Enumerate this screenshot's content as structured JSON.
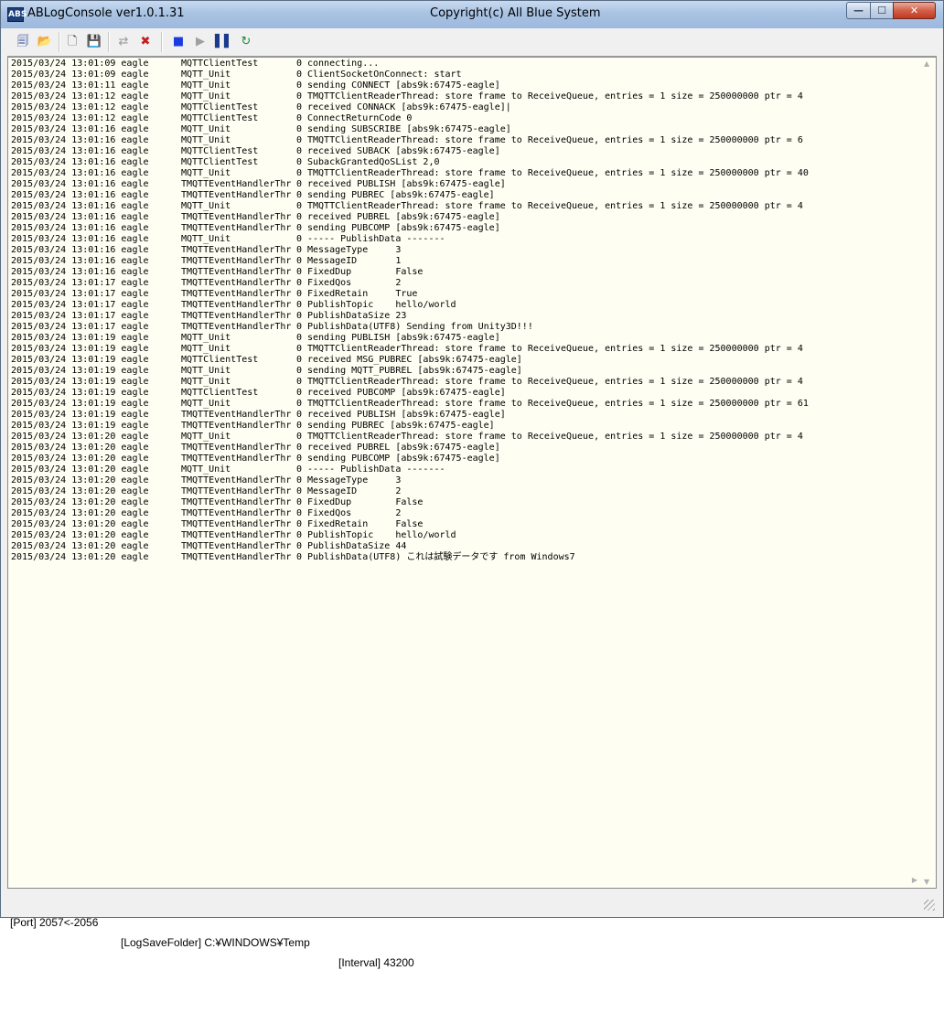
{
  "titlebar": {
    "icon_label": "ABS",
    "app_title": "ABLogConsole ver1.0.1.31",
    "subtitle": "Copyright(c) All Blue System",
    "minimize_glyph": "—",
    "maximize_glyph": "☐",
    "close_glyph": "✕"
  },
  "toolbar": {
    "buttons": [
      {
        "name": "connect-icon",
        "glyph": "🗐",
        "color": "#1a3b8c"
      },
      {
        "name": "open-log-icon",
        "glyph": "📂",
        "color": "#c89a20"
      },
      {
        "name": "new-icon",
        "glyph": "🗋",
        "color": "#404040"
      },
      {
        "name": "save-icon",
        "glyph": "💾",
        "color": "#202020"
      },
      {
        "name": "connect-network-icon",
        "glyph": "⇄",
        "color": "#9a9a9a"
      },
      {
        "name": "disconnect-network-icon",
        "glyph": "✖",
        "color": "#c02020"
      },
      {
        "name": "stop-icon",
        "glyph": "■",
        "color": "#1a3be0"
      },
      {
        "name": "play-icon",
        "glyph": "▶",
        "color": "#a0a0a0"
      },
      {
        "name": "pause-icon",
        "glyph": "▌▌",
        "color": "#1a3b8c"
      },
      {
        "name": "refresh-icon",
        "glyph": "↻",
        "color": "#1f8a3a"
      }
    ]
  },
  "log": [
    {
      "date": "2015/03/24 13:01:09 eagle",
      "source": "MQTTClientTest",
      "level": "0",
      "message": "connecting..."
    },
    {
      "date": "2015/03/24 13:01:09 eagle",
      "source": "MQTT_Unit",
      "level": "0",
      "message": "ClientSocketOnConnect: start"
    },
    {
      "date": "2015/03/24 13:01:11 eagle",
      "source": "MQTT_Unit",
      "level": "0",
      "message": "sending CONNECT [abs9k:67475-eagle]"
    },
    {
      "date": "2015/03/24 13:01:12 eagle",
      "source": "MQTT_Unit",
      "level": "0",
      "message": "TMQTTClientReaderThread: store frame to ReceiveQueue, entries = 1 size = 250000000 ptr = 4"
    },
    {
      "date": "2015/03/24 13:01:12 eagle",
      "source": "MQTTClientTest",
      "level": "0",
      "message": "received CONNACK [abs9k:67475-eagle]|"
    },
    {
      "date": "2015/03/24 13:01:12 eagle",
      "source": "MQTTClientTest",
      "level": "0",
      "message": "ConnectReturnCode 0"
    },
    {
      "date": "2015/03/24 13:01:16 eagle",
      "source": "MQTT_Unit",
      "level": "0",
      "message": "sending SUBSCRIBE [abs9k:67475-eagle]"
    },
    {
      "date": "2015/03/24 13:01:16 eagle",
      "source": "MQTT_Unit",
      "level": "0",
      "message": "TMQTTClientReaderThread: store frame to ReceiveQueue, entries = 1 size = 250000000 ptr = 6"
    },
    {
      "date": "2015/03/24 13:01:16 eagle",
      "source": "MQTTClientTest",
      "level": "0",
      "message": "received SUBACK [abs9k:67475-eagle]"
    },
    {
      "date": "2015/03/24 13:01:16 eagle",
      "source": "MQTTClientTest",
      "level": "0",
      "message": "SubackGrantedQoSList 2,0"
    },
    {
      "date": "2015/03/24 13:01:16 eagle",
      "source": "MQTT_Unit",
      "level": "0",
      "message": "TMQTTClientReaderThread: store frame to ReceiveQueue, entries = 1 size = 250000000 ptr = 40"
    },
    {
      "date": "2015/03/24 13:01:16 eagle",
      "source": "TMQTTEventHandlerThr",
      "level": "0",
      "message": "received PUBLISH [abs9k:67475-eagle]"
    },
    {
      "date": "2015/03/24 13:01:16 eagle",
      "source": "TMQTTEventHandlerThr",
      "level": "0",
      "message": "sending PUBREC [abs9k:67475-eagle]"
    },
    {
      "date": "2015/03/24 13:01:16 eagle",
      "source": "MQTT_Unit",
      "level": "0",
      "message": "TMQTTClientReaderThread: store frame to ReceiveQueue, entries = 1 size = 250000000 ptr = 4"
    },
    {
      "date": "2015/03/24 13:01:16 eagle",
      "source": "TMQTTEventHandlerThr",
      "level": "0",
      "message": "received PUBREL [abs9k:67475-eagle]"
    },
    {
      "date": "2015/03/24 13:01:16 eagle",
      "source": "TMQTTEventHandlerThr",
      "level": "0",
      "message": "sending PUBCOMP [abs9k:67475-eagle]"
    },
    {
      "date": "2015/03/24 13:01:16 eagle",
      "source": "MQTT_Unit",
      "level": "0",
      "message": "----- PublishData -------"
    },
    {
      "date": "2015/03/24 13:01:16 eagle",
      "source": "TMQTTEventHandlerThr",
      "level": "0",
      "message": "MessageType     3"
    },
    {
      "date": "2015/03/24 13:01:16 eagle",
      "source": "TMQTTEventHandlerThr",
      "level": "0",
      "message": "MessageID       1"
    },
    {
      "date": "2015/03/24 13:01:16 eagle",
      "source": "TMQTTEventHandlerThr",
      "level": "0",
      "message": "FixedDup        False"
    },
    {
      "date": "2015/03/24 13:01:17 eagle",
      "source": "TMQTTEventHandlerThr",
      "level": "0",
      "message": "FixedQos        2"
    },
    {
      "date": "2015/03/24 13:01:17 eagle",
      "source": "TMQTTEventHandlerThr",
      "level": "0",
      "message": "FixedRetain     True"
    },
    {
      "date": "2015/03/24 13:01:17 eagle",
      "source": "TMQTTEventHandlerThr",
      "level": "0",
      "message": "PublishTopic    hello/world"
    },
    {
      "date": "2015/03/24 13:01:17 eagle",
      "source": "TMQTTEventHandlerThr",
      "level": "0",
      "message": "PublishDataSize 23"
    },
    {
      "date": "2015/03/24 13:01:17 eagle",
      "source": "TMQTTEventHandlerThr",
      "level": "0",
      "message": "PublishData(UTF8) Sending from Unity3D!!!"
    },
    {
      "date": "2015/03/24 13:01:19 eagle",
      "source": "MQTT_Unit",
      "level": "0",
      "message": "sending PUBLISH [abs9k:67475-eagle]"
    },
    {
      "date": "2015/03/24 13:01:19 eagle",
      "source": "MQTT_Unit",
      "level": "0",
      "message": "TMQTTClientReaderThread: store frame to ReceiveQueue, entries = 1 size = 250000000 ptr = 4"
    },
    {
      "date": "2015/03/24 13:01:19 eagle",
      "source": "MQTTClientTest",
      "level": "0",
      "message": "received MSG_PUBREC [abs9k:67475-eagle]"
    },
    {
      "date": "2015/03/24 13:01:19 eagle",
      "source": "MQTT_Unit",
      "level": "0",
      "message": "sending MQTT_PUBREL [abs9k:67475-eagle]"
    },
    {
      "date": "2015/03/24 13:01:19 eagle",
      "source": "MQTT_Unit",
      "level": "0",
      "message": "TMQTTClientReaderThread: store frame to ReceiveQueue, entries = 1 size = 250000000 ptr = 4"
    },
    {
      "date": "2015/03/24 13:01:19 eagle",
      "source": "MQTTClientTest",
      "level": "0",
      "message": "received PUBCOMP [abs9k:67475-eagle]"
    },
    {
      "date": "2015/03/24 13:01:19 eagle",
      "source": "MQTT_Unit",
      "level": "0",
      "message": "TMQTTClientReaderThread: store frame to ReceiveQueue, entries = 1 size = 250000000 ptr = 61"
    },
    {
      "date": "2015/03/24 13:01:19 eagle",
      "source": "TMQTTEventHandlerThr",
      "level": "0",
      "message": "received PUBLISH [abs9k:67475-eagle]"
    },
    {
      "date": "2015/03/24 13:01:19 eagle",
      "source": "TMQTTEventHandlerThr",
      "level": "0",
      "message": "sending PUBREC [abs9k:67475-eagle]"
    },
    {
      "date": "2015/03/24 13:01:20 eagle",
      "source": "MQTT_Unit",
      "level": "0",
      "message": "TMQTTClientReaderThread: store frame to ReceiveQueue, entries = 1 size = 250000000 ptr = 4"
    },
    {
      "date": "2015/03/24 13:01:20 eagle",
      "source": "TMQTTEventHandlerThr",
      "level": "0",
      "message": "received PUBREL [abs9k:67475-eagle]"
    },
    {
      "date": "2015/03/24 13:01:20 eagle",
      "source": "TMQTTEventHandlerThr",
      "level": "0",
      "message": "sending PUBCOMP [abs9k:67475-eagle]"
    },
    {
      "date": "2015/03/24 13:01:20 eagle",
      "source": "MQTT_Unit",
      "level": "0",
      "message": "----- PublishData -------"
    },
    {
      "date": "2015/03/24 13:01:20 eagle",
      "source": "TMQTTEventHandlerThr",
      "level": "0",
      "message": "MessageType     3"
    },
    {
      "date": "2015/03/24 13:01:20 eagle",
      "source": "TMQTTEventHandlerThr",
      "level": "0",
      "message": "MessageID       2"
    },
    {
      "date": "2015/03/24 13:01:20 eagle",
      "source": "TMQTTEventHandlerThr",
      "level": "0",
      "message": "FixedDup        False"
    },
    {
      "date": "2015/03/24 13:01:20 eagle",
      "source": "TMQTTEventHandlerThr",
      "level": "0",
      "message": "FixedQos        2"
    },
    {
      "date": "2015/03/24 13:01:20 eagle",
      "source": "TMQTTEventHandlerThr",
      "level": "0",
      "message": "FixedRetain     False"
    },
    {
      "date": "2015/03/24 13:01:20 eagle",
      "source": "TMQTTEventHandlerThr",
      "level": "0",
      "message": "PublishTopic    hello/world"
    },
    {
      "date": "2015/03/24 13:01:20 eagle",
      "source": "TMQTTEventHandlerThr",
      "level": "0",
      "message": "PublishDataSize 44"
    },
    {
      "date": "2015/03/24 13:01:20 eagle",
      "source": "TMQTTEventHandlerThr",
      "level": "0",
      "message": "PublishData(UTF8) これは試験データです from Windows7"
    }
  ],
  "statusbar": {
    "port": "[Port] 2057<-2056",
    "log_folder": "[LogSaveFolder] C:¥WINDOWS¥Temp",
    "interval": "[Interval] 43200"
  }
}
